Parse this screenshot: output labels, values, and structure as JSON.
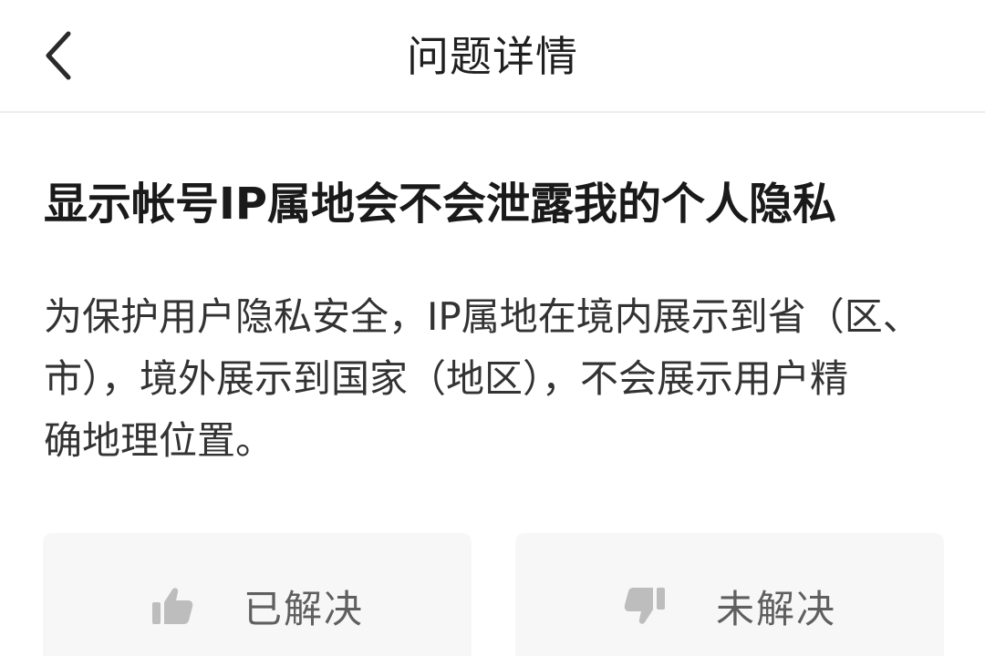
{
  "header": {
    "title": "问题详情",
    "back_icon": "chevron-left-icon"
  },
  "question": {
    "title": "显示帐号IP属地会不会泄露我的个人隐私"
  },
  "answer": {
    "line1": "为保护用户隐私安全，IP属地在境内展示到省（区、",
    "line2": "市），境外展示到国家（地区），不会展示用户精",
    "line3": "确地理位置。"
  },
  "feedback": {
    "resolved_label": "已解决",
    "resolved_icon": "thumbs-up-icon",
    "unresolved_label": "未解决",
    "unresolved_icon": "thumbs-down-icon"
  },
  "colors": {
    "background": "#ffffff",
    "divider": "#ededed",
    "button_bg": "#f7f7f7",
    "icon_gray": "#bdbdbd",
    "label_gray": "#5f5f5f"
  }
}
